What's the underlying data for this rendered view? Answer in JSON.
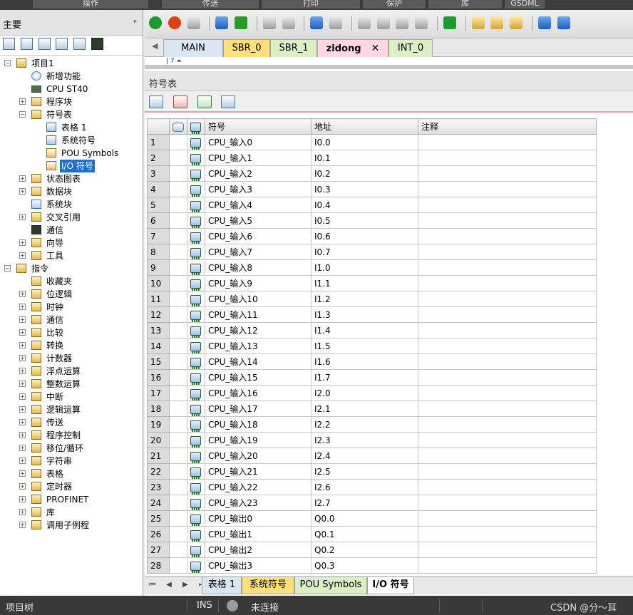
{
  "ribbon": {
    "tabs": [
      "操作",
      "传送",
      "打印",
      "保护",
      "库",
      "GSDML"
    ]
  },
  "left_panel": {
    "title": "主要",
    "pin": "ᵖ"
  },
  "tree": [
    {
      "label": "项目1",
      "exp": "−",
      "icon": "project-icon"
    },
    {
      "label": "新增功能",
      "icon": "help-icon"
    },
    {
      "label": "CPU ST40",
      "icon": "cpu-icon"
    },
    {
      "label": "程序块",
      "exp": "+",
      "icon": "folder-icon"
    },
    {
      "label": "符号表",
      "exp": "−",
      "icon": "folder-icon"
    },
    {
      "label": "表格 1",
      "icon": "table-icon"
    },
    {
      "label": "系统符号",
      "icon": "table-icon"
    },
    {
      "label": "POU Symbols",
      "icon": "pou-icon"
    },
    {
      "label": "I/O 符号",
      "icon": "pou-icon",
      "selected": true
    },
    {
      "label": "状态图表",
      "exp": "+",
      "icon": "folder-icon"
    },
    {
      "label": "数据块",
      "exp": "+",
      "icon": "folder-icon"
    },
    {
      "label": "系统块",
      "icon": "table-icon"
    },
    {
      "label": "交叉引用",
      "exp": "+",
      "icon": "folder-icon"
    },
    {
      "label": "通信",
      "icon": "monitor-icon"
    },
    {
      "label": "向导",
      "exp": "+",
      "icon": "folder-icon"
    },
    {
      "label": "工具",
      "exp": "+",
      "icon": "folder-icon"
    },
    {
      "label": "指令",
      "exp": "−",
      "icon": "folder-icon"
    },
    {
      "label": "收藏夹",
      "icon": "folder-icon"
    },
    {
      "label": "位逻辑",
      "exp": "+",
      "icon": "folder-icon"
    },
    {
      "label": "时钟",
      "exp": "+",
      "icon": "folder-icon"
    },
    {
      "label": "通信",
      "exp": "+",
      "icon": "folder-icon"
    },
    {
      "label": "比较",
      "exp": "+",
      "icon": "folder-icon"
    },
    {
      "label": "转换",
      "exp": "+",
      "icon": "folder-icon"
    },
    {
      "label": "计数器",
      "exp": "+",
      "icon": "folder-icon"
    },
    {
      "label": "浮点运算",
      "exp": "+",
      "icon": "folder-icon"
    },
    {
      "label": "整数运算",
      "exp": "+",
      "icon": "folder-icon"
    },
    {
      "label": "中断",
      "exp": "+",
      "icon": "folder-icon"
    },
    {
      "label": "逻辑运算",
      "exp": "+",
      "icon": "folder-icon"
    },
    {
      "label": "传送",
      "exp": "+",
      "icon": "folder-icon"
    },
    {
      "label": "程序控制",
      "exp": "+",
      "icon": "folder-icon"
    },
    {
      "label": "移位/循环",
      "exp": "+",
      "icon": "folder-icon"
    },
    {
      "label": "字符串",
      "exp": "+",
      "icon": "folder-icon"
    },
    {
      "label": "表格",
      "exp": "+",
      "icon": "folder-icon"
    },
    {
      "label": "定时器",
      "exp": "+",
      "icon": "folder-icon"
    },
    {
      "label": "PROFINET",
      "exp": "+",
      "icon": "folder-icon"
    },
    {
      "label": "库",
      "exp": "+",
      "icon": "folder-icon"
    },
    {
      "label": "调用子例程",
      "exp": "+",
      "icon": "folder-icon"
    }
  ],
  "editor": {
    "program_tabs": {
      "main": "MAIN",
      "sbr0": "SBR_0",
      "sbr1": "SBR_1",
      "zidong": "zidong",
      "zidong_close": "✕",
      "int0": "INT_0"
    },
    "code_hint": "| 7 ⏶"
  },
  "symbol_table": {
    "title": "符号表",
    "headers": {
      "symbol": "符号",
      "address": "地址",
      "comment": "注释"
    },
    "rows": [
      {
        "n": "1",
        "symbol": "CPU_输入0",
        "address": "I0.0",
        "comment": ""
      },
      {
        "n": "2",
        "symbol": "CPU_输入1",
        "address": "I0.1",
        "comment": ""
      },
      {
        "n": "3",
        "symbol": "CPU_输入2",
        "address": "I0.2",
        "comment": ""
      },
      {
        "n": "4",
        "symbol": "CPU_输入3",
        "address": "I0.3",
        "comment": ""
      },
      {
        "n": "5",
        "symbol": "CPU_输入4",
        "address": "I0.4",
        "comment": ""
      },
      {
        "n": "6",
        "symbol": "CPU_输入5",
        "address": "I0.5",
        "comment": ""
      },
      {
        "n": "7",
        "symbol": "CPU_输入6",
        "address": "I0.6",
        "comment": ""
      },
      {
        "n": "8",
        "symbol": "CPU_输入7",
        "address": "I0.7",
        "comment": ""
      },
      {
        "n": "9",
        "symbol": "CPU_输入8",
        "address": "I1.0",
        "comment": ""
      },
      {
        "n": "10",
        "symbol": "CPU_输入9",
        "address": "I1.1",
        "comment": ""
      },
      {
        "n": "11",
        "symbol": "CPU_输入10",
        "address": "I1.2",
        "comment": ""
      },
      {
        "n": "12",
        "symbol": "CPU_输入11",
        "address": "I1.3",
        "comment": ""
      },
      {
        "n": "13",
        "symbol": "CPU_输入12",
        "address": "I1.4",
        "comment": ""
      },
      {
        "n": "14",
        "symbol": "CPU_输入13",
        "address": "I1.5",
        "comment": ""
      },
      {
        "n": "15",
        "symbol": "CPU_输入14",
        "address": "I1.6",
        "comment": ""
      },
      {
        "n": "16",
        "symbol": "CPU_输入15",
        "address": "I1.7",
        "comment": ""
      },
      {
        "n": "17",
        "symbol": "CPU_输入16",
        "address": "I2.0",
        "comment": ""
      },
      {
        "n": "18",
        "symbol": "CPU_输入17",
        "address": "I2.1",
        "comment": ""
      },
      {
        "n": "19",
        "symbol": "CPU_输入18",
        "address": "I2.2",
        "comment": ""
      },
      {
        "n": "20",
        "symbol": "CPU_输入19",
        "address": "I2.3",
        "comment": ""
      },
      {
        "n": "21",
        "symbol": "CPU_输入20",
        "address": "I2.4",
        "comment": ""
      },
      {
        "n": "22",
        "symbol": "CPU_输入21",
        "address": "I2.5",
        "comment": ""
      },
      {
        "n": "23",
        "symbol": "CPU_输入22",
        "address": "I2.6",
        "comment": ""
      },
      {
        "n": "24",
        "symbol": "CPU_输入23",
        "address": "I2.7",
        "comment": ""
      },
      {
        "n": "25",
        "symbol": "CPU_输出0",
        "address": "Q0.0",
        "comment": ""
      },
      {
        "n": "26",
        "symbol": "CPU_输出1",
        "address": "Q0.1",
        "comment": ""
      },
      {
        "n": "27",
        "symbol": "CPU_输出2",
        "address": "Q0.2",
        "comment": ""
      },
      {
        "n": "28",
        "symbol": "CPU_输出3",
        "address": "Q0.3",
        "comment": ""
      }
    ]
  },
  "bottom_tabs": {
    "nav": "⏮ ◀ ▶ ⏭",
    "t1": "表格 1",
    "t2": "系统符号",
    "t3": "POU Symbols",
    "t4": "I/O 符号"
  },
  "status": {
    "project_tree": "项目树",
    "mode": "INS",
    "connection": "未连接",
    "watermark": "CSDN @分～耳"
  }
}
